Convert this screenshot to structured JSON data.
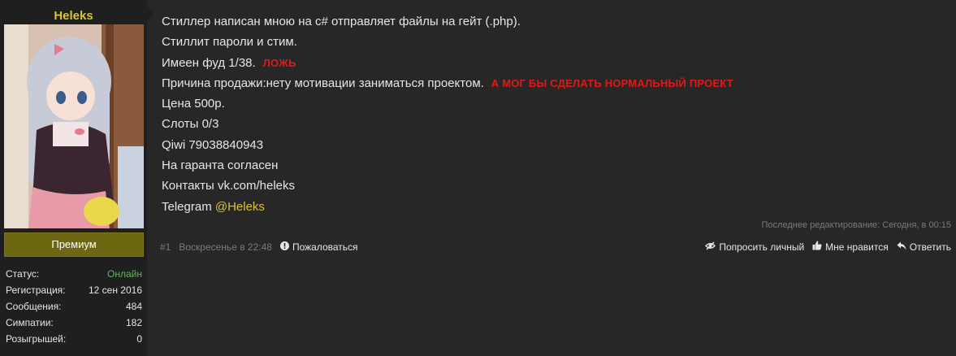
{
  "user": {
    "name": "Heleks",
    "rank": "Премиум",
    "stats": [
      {
        "label": "Статус:",
        "value": "Онлайн"
      },
      {
        "label": "Регистрация:",
        "value": "12 сен 2016"
      },
      {
        "label": "Сообщения:",
        "value": "484"
      },
      {
        "label": "Симпатии:",
        "value": "182"
      },
      {
        "label": "Розыгрышей:",
        "value": "0"
      }
    ]
  },
  "post": {
    "lines": [
      "Стиллер написан мною на c# отправляет файлы на гейт (.php).",
      "Стиллит пароли и стим.",
      "Имеен фуд 1/38.",
      "Причина продажи:нету мотивации заниматься проектом.",
      "Цена 500р.",
      "Слоты 0/3",
      "Qiwi 79038840943",
      "На гаранта согласен",
      "Контакты vk.com/heleks",
      "Telegram "
    ],
    "telegram_handle": "@Heleks",
    "notes": {
      "fud": "ЛОЖЬ",
      "reason": "А МОГ БЫ СДЕЛАТЬ НОРМАЛЬНЫЙ ПРОЕКТ"
    },
    "edited": "Последнее редактирование: Сегодня, в 00:15"
  },
  "footer": {
    "number": "#1",
    "date": "Воскресенье в 22:48",
    "report": "Пожаловаться",
    "actions": [
      "Попросить личный",
      "Мне нравится",
      "Ответить"
    ]
  },
  "colors": {
    "username": "#d7c52b",
    "online": "#5cb85c",
    "rank_badge": "#6e6712",
    "note_red": "#e01818",
    "link_yellow": "#d9c23a"
  }
}
